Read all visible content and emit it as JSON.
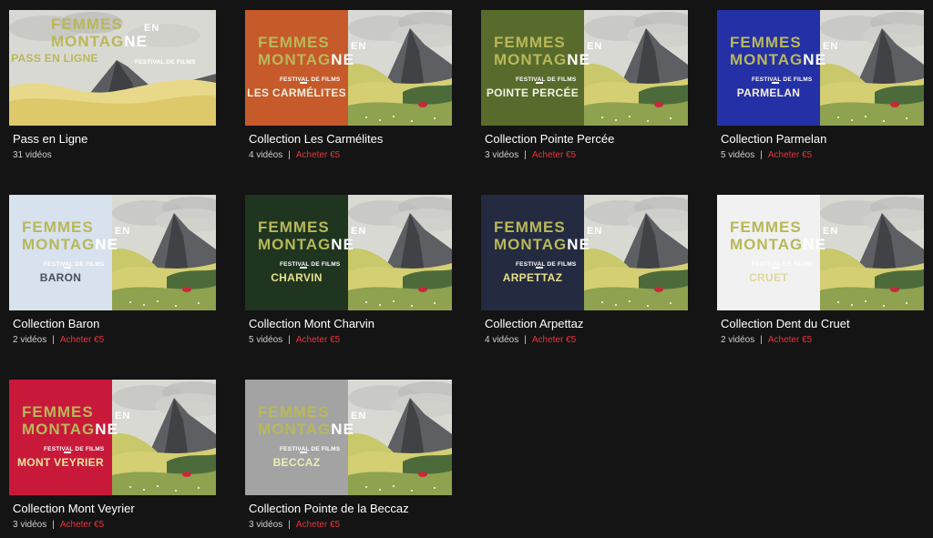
{
  "brand": {
    "line1": "FEMMES",
    "line2_a": "MONTAG",
    "line2_b": "NE",
    "en": "EN",
    "festival": "FESTIVAL DE FILMS"
  },
  "buy_label": "Acheter €5",
  "separator": "|",
  "cards": [
    {
      "title": "Pass en Ligne",
      "count": "31 vidéos",
      "panel_label": "PASS EN LIGNE",
      "panel_color": "#e9e9e6",
      "label_color": "#b8b85a",
      "variant": "full"
    },
    {
      "title": "Collection Les Carmélites",
      "count": "4 vidéos",
      "panel_label": "LES CARMÉLITES",
      "panel_color": "#c65a2a",
      "label_color": "#f3f0e0"
    },
    {
      "title": "Collection Pointe Percée",
      "count": "3 vidéos",
      "panel_label": "POINTE PERCÉE",
      "panel_color": "#586b2c",
      "label_color": "#f3f0e0"
    },
    {
      "title": "Collection Parmelan",
      "count": "5 vidéos",
      "panel_label": "PARMELAN",
      "panel_color": "#2430a6",
      "label_color": "#f3f0e0"
    },
    {
      "title": "Collection Baron",
      "count": "2 vidéos",
      "panel_label": "BARON",
      "panel_color": "#d8e1ee",
      "label_color": "#4a4f5a"
    },
    {
      "title": "Collection Mont Charvin",
      "count": "5 vidéos",
      "panel_label": "CHARVIN",
      "panel_color": "#1f3520",
      "label_color": "#e6e08a"
    },
    {
      "title": "Collection Arpettaz",
      "count": "4 vidéos",
      "panel_label": "ARPETTAZ",
      "panel_color": "#242a40",
      "label_color": "#e6e08a"
    },
    {
      "title": "Collection Dent du Cruet",
      "count": "2 vidéos",
      "panel_label": "CRUET",
      "panel_color": "#f1f1f1",
      "label_color": "#dcd7a0"
    },
    {
      "title": "Collection Mont Veyrier",
      "count": "3 vidéos",
      "panel_label": "MONT VEYRIER",
      "panel_color": "#c8193a",
      "label_color": "#f3e6a0"
    },
    {
      "title": "Collection Pointe de la Beccaz",
      "count": "3 vidéos",
      "panel_label": "BECCAZ",
      "panel_color": "#a3a3a3",
      "label_color": "#f1ecb4"
    }
  ]
}
